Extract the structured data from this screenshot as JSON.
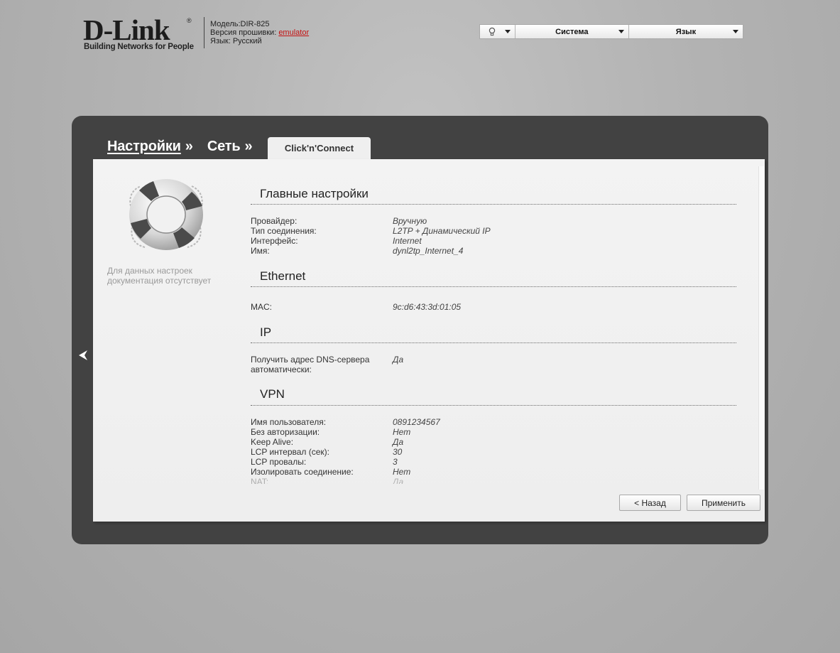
{
  "header": {
    "logo_text": "D-Link",
    "logo_registered": "®",
    "logo_tagline": "Building Networks for People",
    "model_label": "Модель:",
    "model_value": "DIR-825",
    "firmware_label": "Версия прошивки:",
    "firmware_value": "emulator",
    "language_label": "Язык:",
    "language_value": "Русский"
  },
  "topbar": {
    "bulb_icon": "lightbulb-icon",
    "system_label": "Система",
    "language_label": "Язык"
  },
  "breadcrumb": {
    "settings": "Настройки",
    "settings_sep": "»",
    "network": "Сеть",
    "network_sep": "»",
    "active_tab": "Click'n'Connect"
  },
  "help": {
    "icon": "lifebuoy-icon",
    "text": "Для данных настроек документация отсутствует"
  },
  "sections": {
    "main": {
      "title": "Главные настройки",
      "rows": [
        {
          "label": "Провайдер:",
          "value": "Вручную"
        },
        {
          "label": "Тип соединения:",
          "value": "L2TP + Динамический IP"
        },
        {
          "label": "Интерфейс:",
          "value": "Internet"
        },
        {
          "label": "Имя:",
          "value": "dynl2tp_Internet_4"
        }
      ]
    },
    "ethernet": {
      "title": "Ethernet",
      "rows": [
        {
          "label": "MAC:",
          "value": "9c:d6:43:3d:01:05"
        }
      ]
    },
    "ip": {
      "title": "IP",
      "rows": [
        {
          "label": "Получить адрес DNS-сервера автоматически:",
          "value": "Да"
        }
      ]
    },
    "vpn": {
      "title": "VPN",
      "rows": [
        {
          "label": "Имя пользователя:",
          "value": "0891234567"
        },
        {
          "label": "Без авторизации:",
          "value": "Нет"
        },
        {
          "label": "Keep Alive:",
          "value": "Да"
        },
        {
          "label": "LCP интервал (сек):",
          "value": "30"
        },
        {
          "label": "LCP провалы:",
          "value": "3"
        },
        {
          "label": "Изолировать соединение:",
          "value": "Нет"
        },
        {
          "label": "NAT:",
          "value": "Да"
        }
      ]
    }
  },
  "buttons": {
    "back": "< Назад",
    "apply": "Применить"
  },
  "nav": {
    "back_arrow_icon": "back-arrow-icon"
  }
}
